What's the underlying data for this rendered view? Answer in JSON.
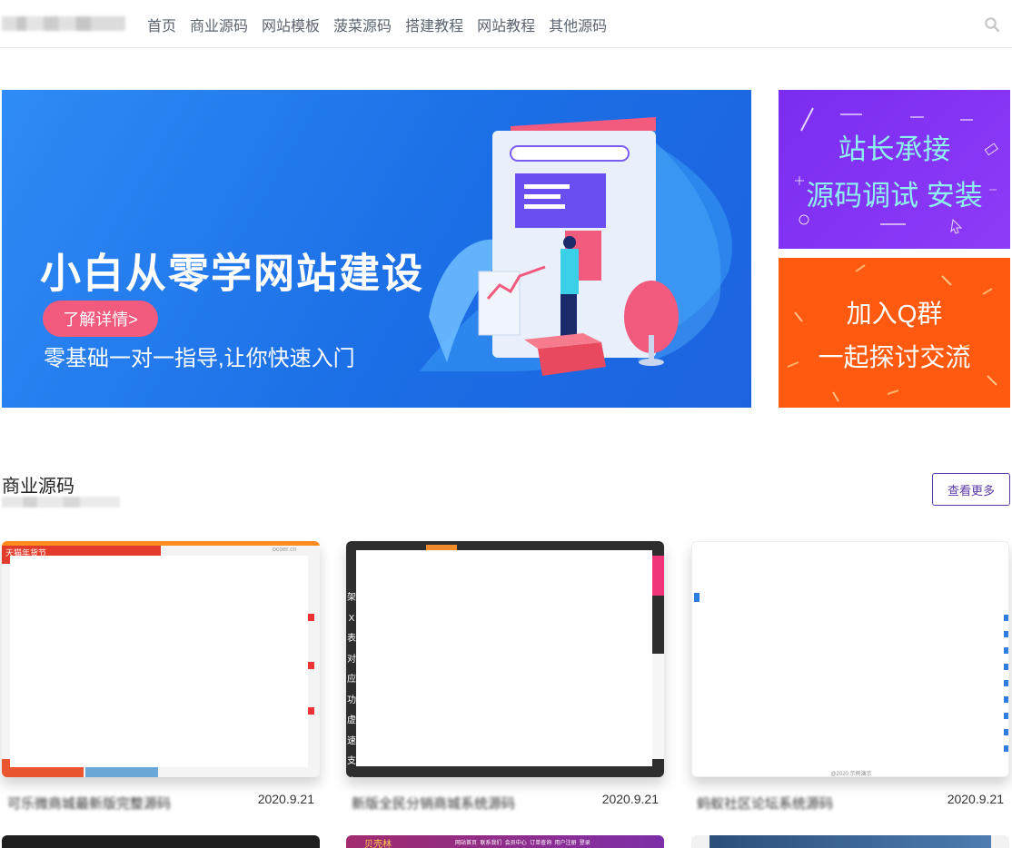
{
  "nav": {
    "items": [
      "首页",
      "商业源码",
      "网站模板",
      "菠菜源码",
      "搭建教程",
      "网站教程",
      "其他源码"
    ]
  },
  "banner": {
    "title": "小白从零学网站建设",
    "subtitle": "零基础一对一指导,让你快速入门",
    "button": "了解详情>"
  },
  "promos": {
    "purple": {
      "line1": "站长承接",
      "line2": "源码调试 安装"
    },
    "orange": {
      "line1": "加入Q群",
      "line2": "一起探讨交流"
    }
  },
  "section": {
    "title": "商业源码",
    "more": "查看更多"
  },
  "cards": [
    {
      "title": "可乐微商城最新版完整源码",
      "date": "2020.9.21",
      "thumb_text_left": "天猫年货节",
      "thumb_text_right": "ocoer.cn"
    },
    {
      "title": "新版全民分销商城系统源码",
      "date": "2020.9.21",
      "thumb_side_chars": [
        "架",
        "X表",
        "对",
        "应",
        "功",
        "虚",
        "速",
        "支",
        "欢"
      ]
    },
    {
      "title": "蚂蚁社区论坛系统源码",
      "date": "2020.9.21",
      "thumb_footer": "@2020 示例演示"
    }
  ],
  "row2": {
    "card2_nav": [
      "网站首页",
      "联系我们",
      "会员中心",
      "订单查询",
      "用户注册",
      "登录"
    ],
    "card2_brand": "贝壳林"
  },
  "colors": {
    "nav_text": "#5b6470",
    "banner_bg": "#1c6fe6",
    "button_pink": "#f25a7e",
    "promo_purple": "#8633f5",
    "promo_orange": "#ff5a0f",
    "accent_purple": "#5a3aa8"
  }
}
